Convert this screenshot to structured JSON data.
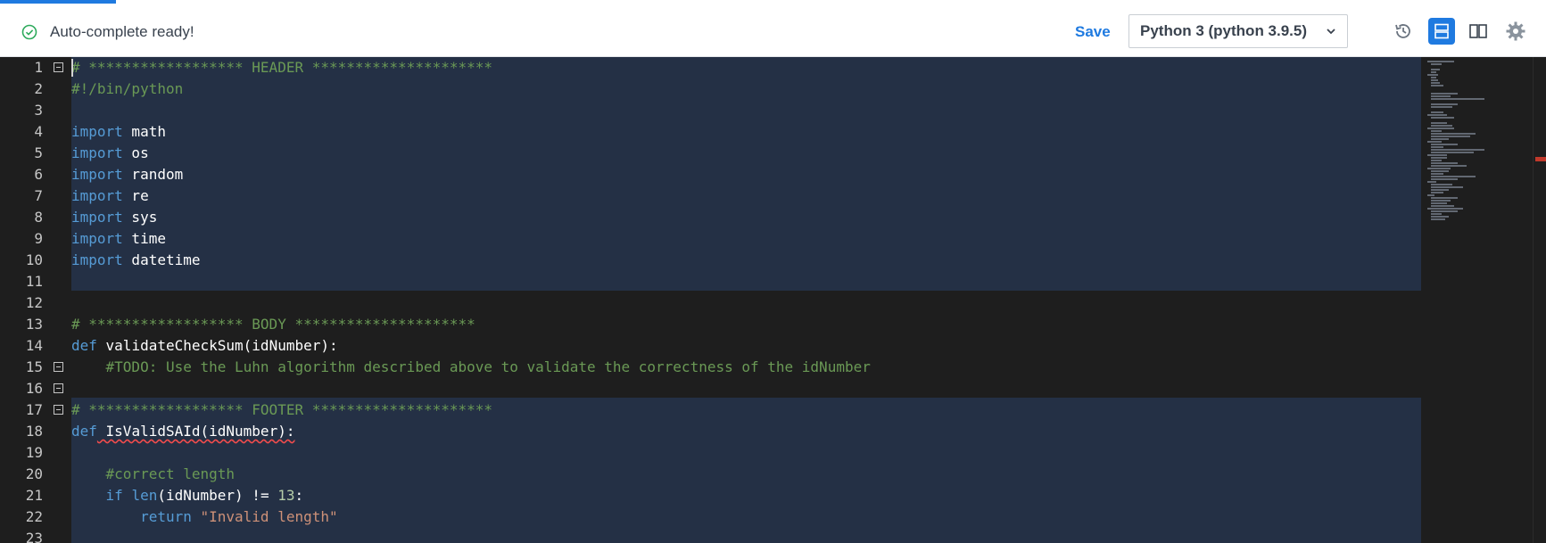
{
  "toolbar": {
    "status_text": "Auto-complete ready!",
    "save_label": "Save",
    "language": "Python 3 (python 3.9.5)"
  },
  "icons": {
    "status": "check-circle-icon",
    "dropdown": "chevron-down-icon",
    "history": "history-icon",
    "layout_rows": "layout-rows-icon",
    "layout_columns": "layout-columns-icon",
    "settings": "gear-icon"
  },
  "colors": {
    "accent": "#1f7ae0",
    "editor_bg": "#1e1e1e",
    "selected_bg": "#243045",
    "comment": "#6a9955",
    "keyword": "#569cd6"
  },
  "code": [
    {
      "num": "1",
      "tokens": [
        [
          "c-comment",
          "# ****************** HEADER *********************"
        ]
      ]
    },
    {
      "num": "2",
      "tokens": [
        [
          "c-comment",
          "#!/bin/python"
        ]
      ]
    },
    {
      "num": "3",
      "tokens": []
    },
    {
      "num": "4",
      "tokens": [
        [
          "c-kw",
          "import"
        ],
        [
          "c-white",
          " math"
        ]
      ]
    },
    {
      "num": "5",
      "tokens": [
        [
          "c-kw",
          "import"
        ],
        [
          "c-white",
          " os"
        ]
      ]
    },
    {
      "num": "6",
      "tokens": [
        [
          "c-kw",
          "import"
        ],
        [
          "c-white",
          " random"
        ]
      ]
    },
    {
      "num": "7",
      "tokens": [
        [
          "c-kw",
          "import"
        ],
        [
          "c-white",
          " re"
        ]
      ]
    },
    {
      "num": "8",
      "tokens": [
        [
          "c-kw",
          "import"
        ],
        [
          "c-white",
          " sys"
        ]
      ]
    },
    {
      "num": "9",
      "tokens": [
        [
          "c-kw",
          "import"
        ],
        [
          "c-white",
          " time"
        ]
      ]
    },
    {
      "num": "10",
      "tokens": [
        [
          "c-kw",
          "import"
        ],
        [
          "c-white",
          " datetime"
        ]
      ]
    },
    {
      "num": "11",
      "tokens": []
    },
    {
      "num": "12",
      "tokens": []
    },
    {
      "num": "13",
      "tokens": [
        [
          "c-comment",
          "# ****************** BODY *********************"
        ]
      ]
    },
    {
      "num": "14",
      "tokens": [
        [
          "c-kw",
          "def"
        ],
        [
          "c-white",
          " validateCheckSum(idNumber):"
        ]
      ]
    },
    {
      "num": "15",
      "tokens": [
        [
          "c-comment",
          "    #TODO: Use the Luhn algorithm described above to validate the correctness of the idNumber"
        ]
      ]
    },
    {
      "num": "16",
      "tokens": []
    },
    {
      "num": "17",
      "tokens": [
        [
          "c-comment",
          "# ****************** FOOTER *********************"
        ]
      ]
    },
    {
      "num": "18",
      "tokens": [
        [
          "c-kw",
          "def"
        ],
        [
          "c-white squiggle",
          " IsValidSAId(idNumber):"
        ]
      ]
    },
    {
      "num": "19",
      "tokens": []
    },
    {
      "num": "20",
      "tokens": [
        [
          "c-comment",
          "    #correct length"
        ]
      ]
    },
    {
      "num": "21",
      "tokens": [
        [
          "c-kw",
          "    if"
        ],
        [
          "c-white",
          " "
        ],
        [
          "c-kw",
          "len"
        ],
        [
          "c-white",
          "(idNumber) != "
        ],
        [
          "c-num",
          "13"
        ],
        [
          "c-white",
          ":"
        ]
      ]
    },
    {
      "num": "22",
      "tokens": [
        [
          "c-kw",
          "        return"
        ],
        [
          "c-white",
          " "
        ],
        [
          "c-str",
          "\"Invalid length\""
        ]
      ]
    },
    {
      "num": "23",
      "tokens": []
    }
  ]
}
